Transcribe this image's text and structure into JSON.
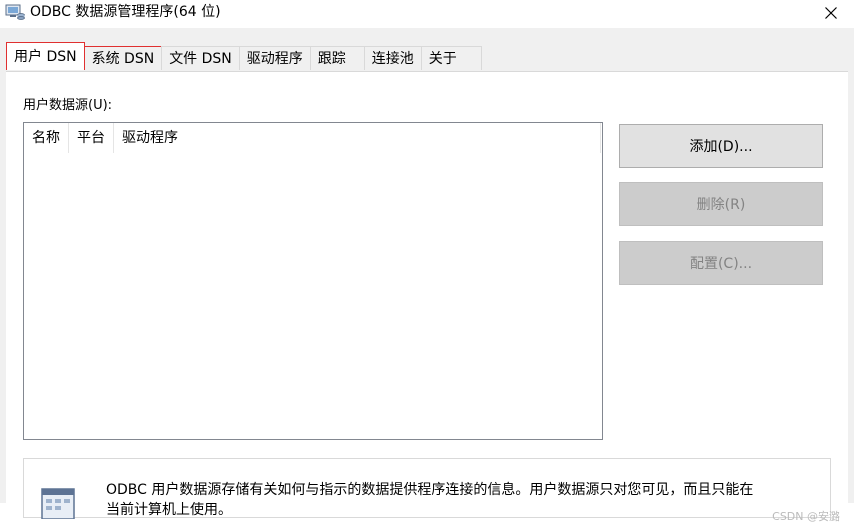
{
  "window": {
    "title": "ODBC 数据源管理程序(64 位)"
  },
  "tabs": [
    {
      "label": "用户 DSN"
    },
    {
      "label": "系统 DSN"
    },
    {
      "label": "文件 DSN"
    },
    {
      "label": "驱动程序"
    },
    {
      "label": "跟踪"
    },
    {
      "label": "连接池"
    },
    {
      "label": "关于"
    }
  ],
  "user_dsn": {
    "section_label": "用户数据源(U):",
    "columns": [
      "名称",
      "平台",
      "驱动程序"
    ],
    "buttons": {
      "add": "添加(D)...",
      "remove": "删除(R)",
      "configure": "配置(C)..."
    },
    "info_line1": "ODBC 用户数据源存储有关如何与指示的数据提供程序连接的信息。用户数据源只对您可见，而且只能在",
    "info_line2": "当前计算机上使用。"
  },
  "watermark": "CSDN @安潞",
  "colors": {
    "highlight_outline": "#e03030",
    "dialog_bg": "#f0f0f0",
    "disabled_button": "#cccccc"
  }
}
